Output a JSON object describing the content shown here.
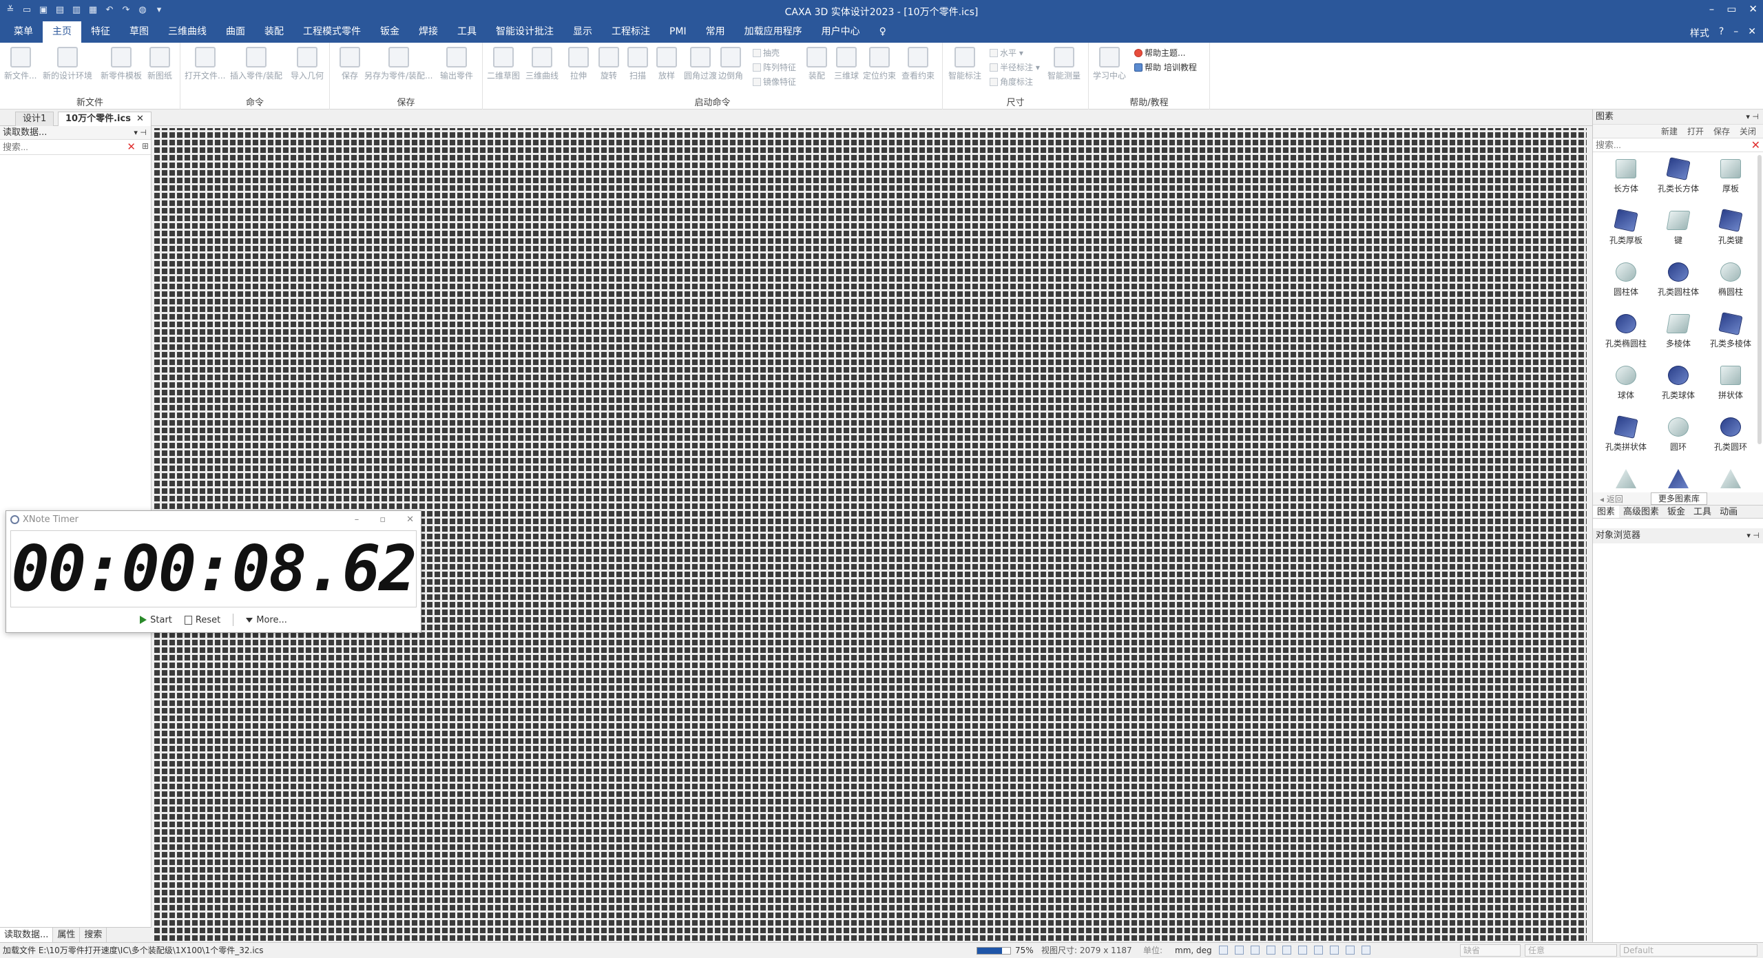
{
  "app": {
    "title": "CAXA 3D 实体设计2023 - [10万个零件.ics]",
    "win_controls": [
      "–",
      "▭",
      "✕"
    ]
  },
  "menubar": {
    "tabs": [
      "菜单",
      "主页",
      "特征",
      "草图",
      "三维曲线",
      "曲面",
      "装配",
      "工程模式零件",
      "钣金",
      "焊接",
      "工具",
      "智能设计批注",
      "显示",
      "工程标注",
      "PMI",
      "常用",
      "加载应用程序",
      "用户中心"
    ],
    "active_index": 1,
    "style_label": "样式",
    "right_icons": [
      "?",
      "–",
      "✕"
    ]
  },
  "ribbon": {
    "groups": [
      {
        "label": "新文件",
        "buttons": [
          "新文件...",
          "新的设计环境",
          "新零件模板",
          "新图纸"
        ]
      },
      {
        "label": "命令",
        "buttons": [
          "打开文件...",
          "插入零件/装配",
          "导入几何"
        ]
      },
      {
        "label": "保存",
        "buttons": [
          "保存",
          "另存为零件/装配...",
          "输出零件"
        ]
      },
      {
        "label": "启动命令",
        "buttons": [
          "二维草图",
          "三维曲线",
          "拉伸",
          "旋转",
          "扫描",
          "放样",
          "圆角过渡",
          "边倒角"
        ],
        "small": [
          "抽壳",
          "阵列特征",
          "镜像特征"
        ],
        "buttons2": [
          "装配",
          "三维球",
          "定位约束",
          "查看约束"
        ]
      },
      {
        "label": "尺寸",
        "buttons": [
          "智能标注",
          "智能测量"
        ],
        "small": [
          "水平",
          "半径标注",
          "角度标注"
        ]
      },
      {
        "label": "帮助/教程",
        "buttons": [
          "学习中心"
        ],
        "small": [
          "帮助主题...",
          "帮助 培训教程"
        ]
      }
    ]
  },
  "doc_tabs": [
    {
      "label": "设计1"
    },
    {
      "label": "10万个零件.ics",
      "close": "✕"
    }
  ],
  "left_panel": {
    "title": "读取数据...",
    "search_placeholder": "搜索...",
    "bottom_tabs": [
      "读取数据...",
      "属性",
      "搜索"
    ]
  },
  "timer": {
    "title": "XNote Timer",
    "time": "00:00:08.62",
    "start": "Start",
    "reset": "Reset",
    "more": "More..."
  },
  "right_panel": {
    "title": "图素",
    "tools": [
      "新建",
      "打开",
      "保存",
      "关闭"
    ],
    "search_placeholder": "搜索...",
    "shapes": [
      "长方体",
      "孔类长方体",
      "厚板",
      "孔类厚板",
      "键",
      "孔类键",
      "圆柱体",
      "孔类圆柱体",
      "椭圆柱",
      "孔类椭圆柱",
      "多棱体",
      "孔类多棱体",
      "球体",
      "孔类球体",
      "拼状体",
      "孔类拼状体",
      "圆环",
      "孔类圆环"
    ],
    "back": "返回",
    "more_lib": "更多图素库",
    "tabs": [
      "图素",
      "高级图素",
      "钣金",
      "工具",
      "动画"
    ],
    "object_browser": "对象浏览器"
  },
  "status": {
    "message": "加载文件 E:\\10万零件打开速度\\IC\\多个装配级\\1X100\\1个零件_32.ics",
    "progress": 0.75,
    "percent": "75%",
    "view_size": "视图尺寸: 2079 x 1187",
    "unit_label": "单位:",
    "unit": "mm, deg",
    "select1": "缺省",
    "select2": "任意",
    "select3": "Default"
  },
  "colors": {
    "title_blue": "#2b579a",
    "part_dark": "#3b3b3b"
  }
}
